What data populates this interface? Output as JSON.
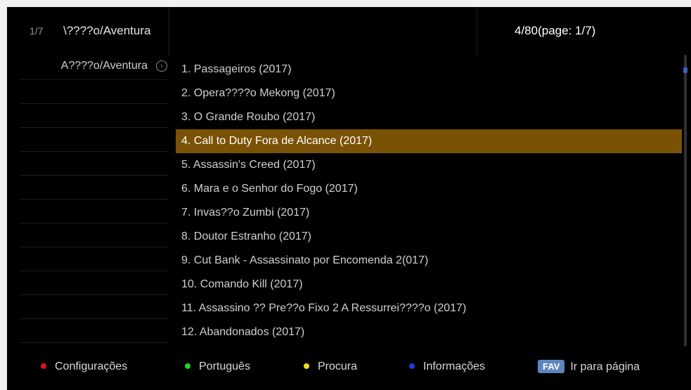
{
  "header": {
    "page_indicator": "1/7",
    "category": "\\????o/Aventura",
    "count": "4/80(page: 1/7)"
  },
  "categories": [
    {
      "label": "A????o/Aventura",
      "arrow": "›"
    }
  ],
  "movies": [
    "1. Passageiros (2017)",
    "2. Opera????o Mekong (2017)",
    "3. O Grande Roubo (2017)",
    "4. Call to Duty Fora de Alcance (2017)",
    "5. Assassin's Creed (2017)",
    "6. Mara e o Senhor do Fogo (2017)",
    "7. Invas??o Zumbi (2017)",
    "8. Doutor Estranho (2017)",
    "9. Cut Bank - Assassinato por  Encomenda 2(017)",
    "10. Comando Kill (2017)",
    "11. Assassino ?? Pre??o Fixo 2 A Ressurrei????o (2017)",
    "12. Abandonados (2017)"
  ],
  "selected_index": 3,
  "scroll_position": 0.05,
  "footer": {
    "red": {
      "label": "Configurações",
      "color": "#e3121a"
    },
    "green": {
      "label": "Português",
      "color": "#22d322"
    },
    "yellow": {
      "label": "Procura",
      "color": "#ece316"
    },
    "blue": {
      "label": "Informações",
      "color": "#1a3fe0"
    },
    "fav": {
      "badge": "FAV",
      "label": "Ir para página"
    }
  },
  "colors": {
    "selected_row": "#7a5205",
    "background": "#000000"
  }
}
